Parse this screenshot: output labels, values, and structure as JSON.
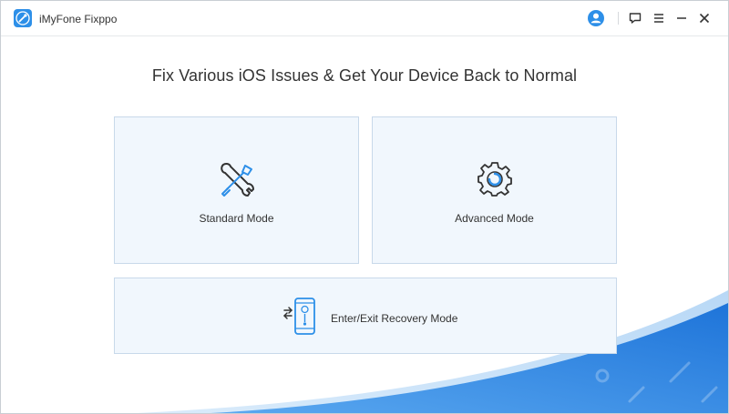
{
  "app": {
    "title": "iMyFone Fixppo",
    "logo_icon": "wrench-logo-icon"
  },
  "titlebar": {
    "account_icon": "user-account-icon",
    "feedback_icon": "feedback-chat-icon",
    "menu_icon": "hamburger-menu-icon",
    "minimize_icon": "minimize-icon",
    "close_icon": "close-icon"
  },
  "main": {
    "heading": "Fix Various iOS Issues & Get Your Device Back to Normal",
    "modes": [
      {
        "label": "Standard Mode",
        "icon": "wrench-screwdriver-icon"
      },
      {
        "label": "Advanced Mode",
        "icon": "gear-icon"
      }
    ],
    "recovery": {
      "label": "Enter/Exit Recovery Mode",
      "icon": "phone-recovery-icon"
    }
  },
  "colors": {
    "accent": "#2d8fe8",
    "card_bg": "#f1f7fd",
    "card_border": "#c8d9ea",
    "wave": "#2f86e6"
  }
}
